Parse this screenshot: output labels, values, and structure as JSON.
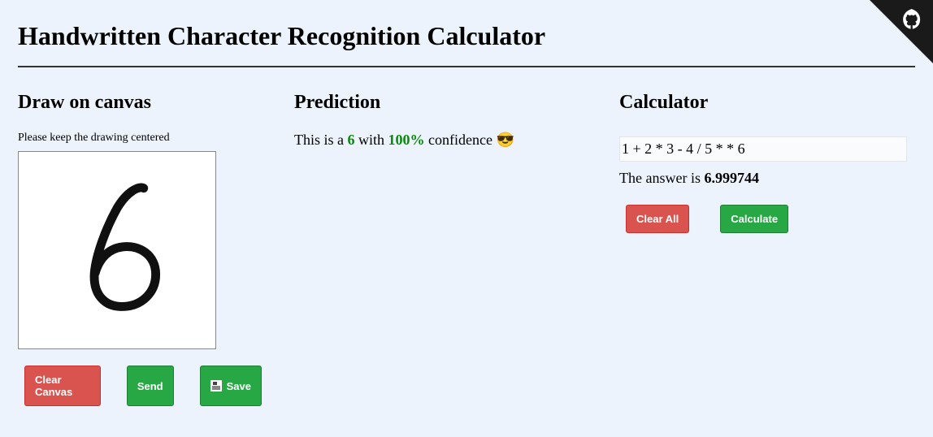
{
  "title": "Handwritten Character Recognition Calculator",
  "draw": {
    "heading": "Draw on canvas",
    "hint": "Please keep the drawing centered",
    "drawn_digit": "6",
    "buttons": {
      "clear": "Clear Canvas",
      "send": "Send",
      "save": "Save"
    }
  },
  "prediction": {
    "heading": "Prediction",
    "prefix": "This is a ",
    "value": "6",
    "middle": " with ",
    "confidence": "100%",
    "suffix": " confidence ",
    "emoji": "😎"
  },
  "calculator": {
    "heading": "Calculator",
    "expression": "1 + 2 * 3 - 4 / 5 * * 6",
    "answer_label": "The answer is ",
    "answer_value": "6.999744",
    "buttons": {
      "clear_all": "Clear All",
      "calculate": "Calculate"
    }
  }
}
